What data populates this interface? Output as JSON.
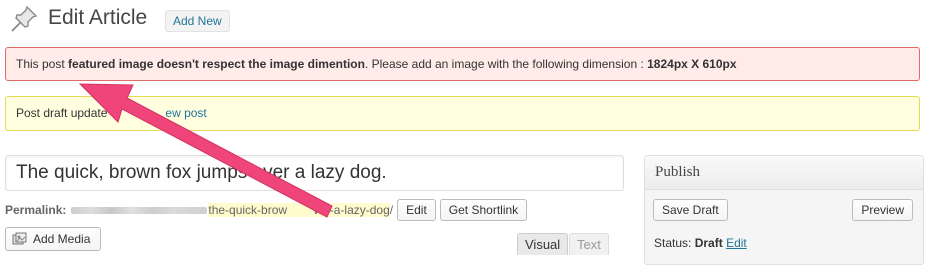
{
  "header": {
    "title": "Edit Article",
    "add_new_label": "Add New"
  },
  "notices": {
    "error": {
      "prefix": "This post ",
      "bold": "featured image doesn't respect the image dimention",
      "middle": ". Please add an image with the following dimension : ",
      "dimension": "1824px X 610px"
    },
    "updated": {
      "text": "Post draft update",
      "link": "ew post"
    }
  },
  "editor": {
    "post_title": "The quick, brown fox jumps over a lazy dog.",
    "permalink_label": "Permalink:",
    "permalink_slug": "the-quick-brow",
    "permalink_slug_tail": "ver-a-lazy-dog",
    "permalink_sep": "/",
    "edit_label": "Edit",
    "shortlink_label": "Get Shortlink",
    "add_media_label": "Add Media",
    "tab_visual": "Visual",
    "tab_text": "Text"
  },
  "publish_box": {
    "title": "Publish",
    "save_draft_label": "Save Draft",
    "preview_label": "Preview",
    "status_label": "Status:",
    "status_value": "Draft",
    "status_edit_label": "Edit"
  },
  "colors": {
    "error_bg": "#ffebe8",
    "error_border": "#e06b6b",
    "updated_bg": "#ffffe0",
    "updated_border": "#e6db55",
    "link": "#21759b",
    "annotation_arrow": "#f0457a"
  },
  "icons": [
    "pushpin-icon",
    "media-icon"
  ]
}
